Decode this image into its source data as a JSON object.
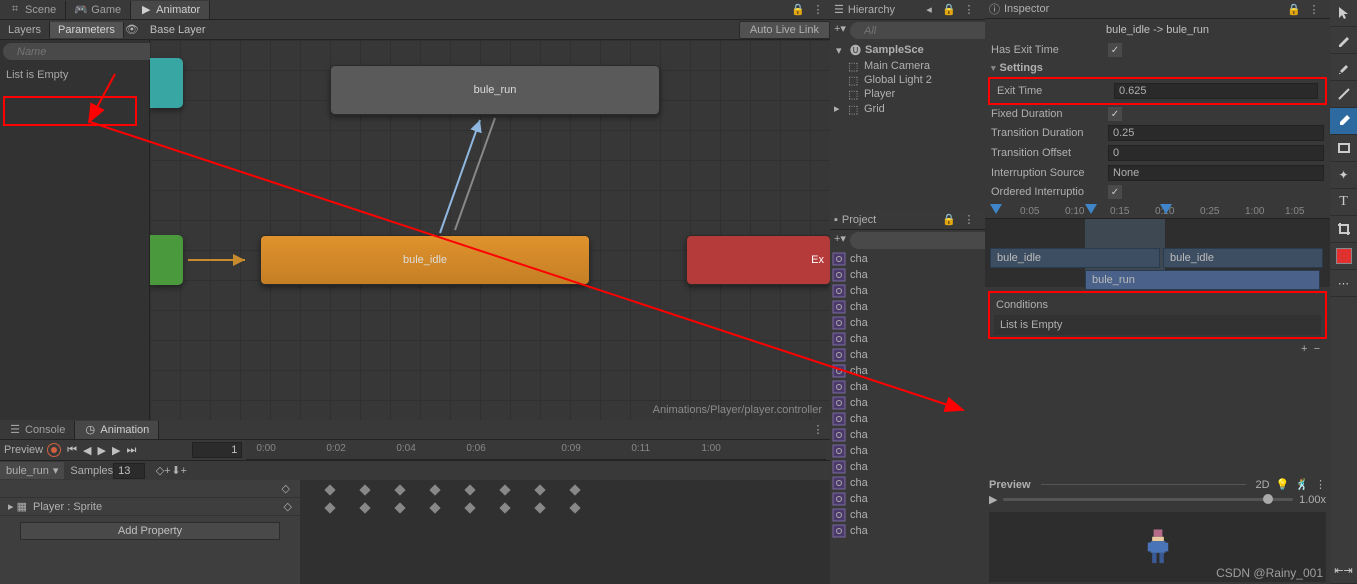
{
  "top_tabs": {
    "scene": "Scene",
    "game": "Game",
    "animator": "Animator"
  },
  "animator": {
    "layers_tab": "Layers",
    "params_tab": "Parameters",
    "breadcrumb": "Base Layer",
    "autolink": "Auto Live Link",
    "search_placeholder": "Name",
    "empty": "List is Empty",
    "path": "Animations/Player/player.controller",
    "nodes": {
      "run": "bule_run",
      "idle": "bule_idle",
      "exit": "Ex"
    }
  },
  "bottom_tabs": {
    "console": "Console",
    "animation": "Animation"
  },
  "animation": {
    "preview": "Preview",
    "frame": "1",
    "clip": "bule_run",
    "samples_label": "Samples",
    "samples": "13",
    "ticks": [
      "0:00",
      "0:02",
      "0:04",
      "0:06",
      "0:09",
      "0:11",
      "1:00"
    ],
    "track1": "",
    "track2": "Player : Sprite",
    "add_property": "Add Property"
  },
  "hierarchy": {
    "title": "Hierarchy",
    "search_placeholder": "All",
    "scene": "SampleSce",
    "items": [
      "Main Camera",
      "Global Light 2",
      "Player",
      "Grid"
    ]
  },
  "project": {
    "title": "Project",
    "items": [
      "cha",
      "cha",
      "cha",
      "cha",
      "cha",
      "cha",
      "cha",
      "cha",
      "cha",
      "cha",
      "cha",
      "cha",
      "cha",
      "cha",
      "cha",
      "cha",
      "cha",
      "cha"
    ]
  },
  "inspector": {
    "title": "Inspector",
    "transition": "bule_idle -> bule_run",
    "has_exit_time": "Has Exit Time",
    "settings": "Settings",
    "exit_time_label": "Exit Time",
    "exit_time": "0.625",
    "fixed_duration": "Fixed Duration",
    "transition_duration_label": "Transition Duration",
    "transition_duration": "0.25",
    "transition_offset_label": "Transition Offset",
    "transition_offset": "0",
    "interruption_label": "Interruption Source",
    "interruption": "None",
    "ordered": "Ordered Interruptio",
    "timeline_ticks": [
      "0:05",
      "0:10",
      "0:15",
      "0:20",
      "0:25",
      "1:00",
      "1:05"
    ],
    "tl_idle": "bule_idle",
    "tl_idle2": "bule_idle",
    "tl_run": "bule_run",
    "conditions": "Conditions",
    "cond_empty": "List is Empty",
    "preview": "Preview",
    "preview_2d": "2D",
    "preview_zoom": "1.00x"
  },
  "watermark": "CSDN @Rainy_001"
}
